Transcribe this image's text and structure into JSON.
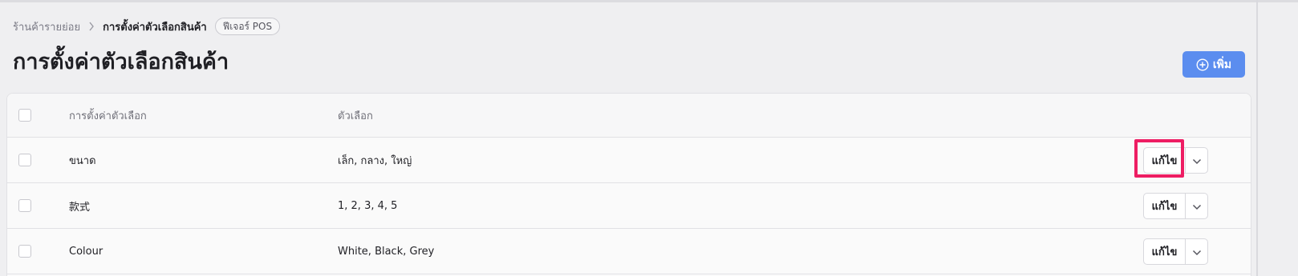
{
  "breadcrumb": {
    "parent": "ร้านค้ารายย่อย",
    "current": "การตั้งค่าตัวเลือกสินค้า",
    "badge": "ฟีเจอร์ POS"
  },
  "page": {
    "title": "การตั้งค่าตัวเลือกสินค้า",
    "add_label": "เพิ่ม"
  },
  "table": {
    "columns": [
      "การตั้งค่าตัวเลือก",
      "ตัวเลือก"
    ],
    "rows": [
      {
        "name": "ขนาด",
        "values": "เล็ก, กลาง, ใหญ่",
        "edit_label": "แก้ไข"
      },
      {
        "name": "款式",
        "values": "1, 2, 3, 4, 5",
        "edit_label": "แก้ไข"
      },
      {
        "name": "Colour",
        "values": "White, Black, Grey",
        "edit_label": "แก้ไข"
      }
    ]
  },
  "colors": {
    "accent": "#5b8def",
    "highlight": "#ee1d63"
  }
}
